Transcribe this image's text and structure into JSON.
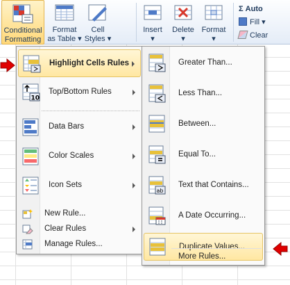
{
  "ribbon": {
    "conditional_formatting": {
      "line1": "Conditional",
      "line2": "Formatting ▾"
    },
    "format_as_table": {
      "line1": "Format",
      "line2": "as Table ▾"
    },
    "cell_styles": {
      "line1": "Cell",
      "line2": "Styles ▾"
    },
    "insert": {
      "line1": "Insert",
      "line2": "▾"
    },
    "delete": {
      "line1": "Delete",
      "line2": "▾"
    },
    "format": {
      "line1": "Format",
      "line2": "▾"
    },
    "autosum": "Σ Auto",
    "fill": "Fill ▾",
    "clear": "Clear"
  },
  "menu": {
    "items": [
      {
        "label": "Highlight Cells Rules",
        "key": "H"
      },
      {
        "label": "Top/Bottom Rules",
        "key": "T"
      },
      {
        "label": "Data Bars",
        "key": "D"
      },
      {
        "label": "Color Scales",
        "key": "S"
      },
      {
        "label": "Icon Sets",
        "key": "I"
      }
    ],
    "small_items": [
      {
        "label": "New Rule..."
      },
      {
        "label": "Clear Rules"
      },
      {
        "label": "Manage Rules..."
      }
    ]
  },
  "submenu": {
    "items": [
      {
        "label": "Greater Than..."
      },
      {
        "label": "Less Than..."
      },
      {
        "label": "Between..."
      },
      {
        "label": "Equal To..."
      },
      {
        "label": "Text that Contains..."
      },
      {
        "label": "A Date Occurring..."
      },
      {
        "label": "Duplicate Values..."
      }
    ],
    "more": "More Rules..."
  },
  "colors": {
    "highlight": "#ffe7a2",
    "arrow": "#e00000",
    "ribbon_text": "#1e395b"
  }
}
